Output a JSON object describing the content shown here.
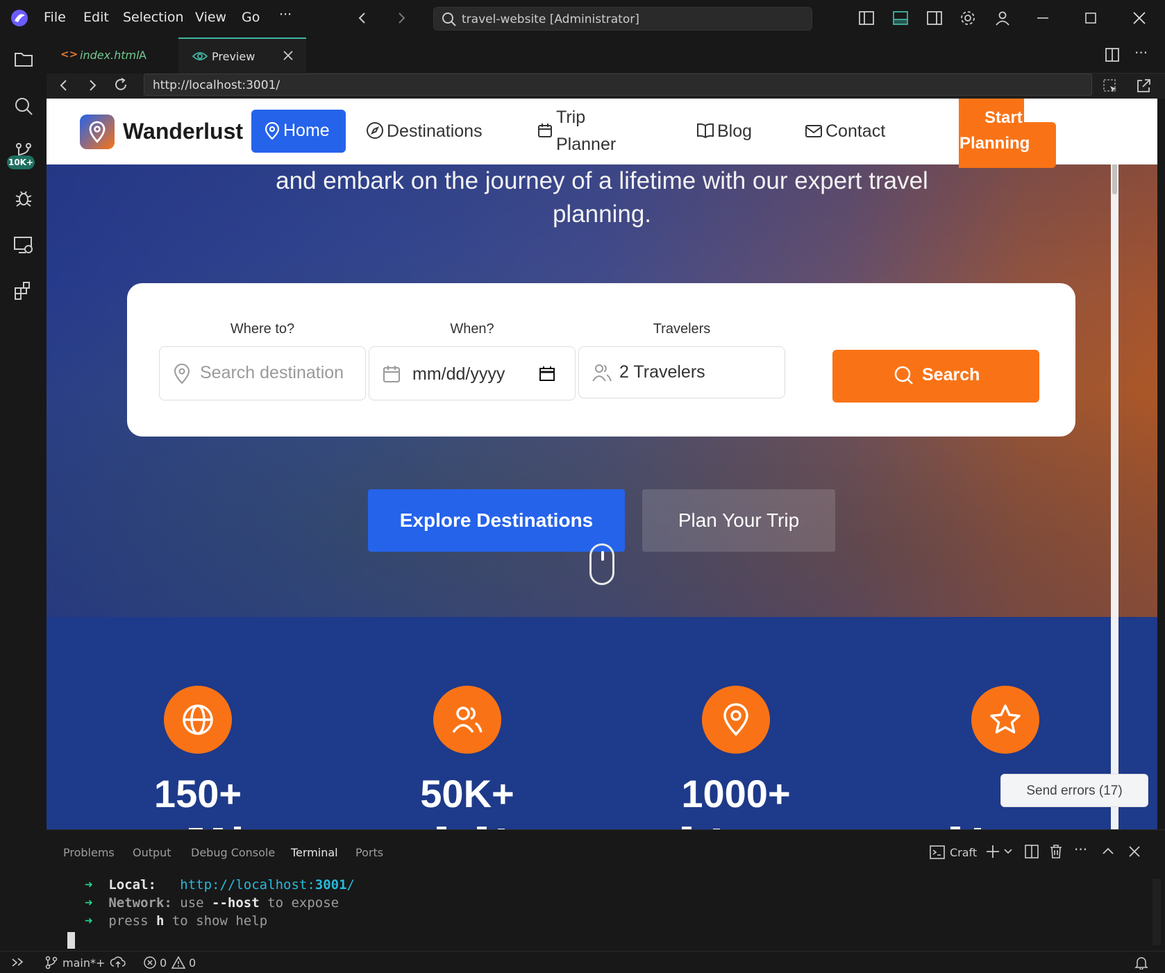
{
  "menu": [
    "File",
    "Edit",
    "Selection",
    "View",
    "Go",
    "···"
  ],
  "command_center": "travel-website [Administrator]",
  "tabs": {
    "index": {
      "name": "index.html",
      "badge": "A"
    },
    "preview": {
      "name": "Preview"
    }
  },
  "activity_badge": "10K+",
  "url": "http://localhost:3001/",
  "site": {
    "brand": "Wanderlust",
    "nav": {
      "home": "Home",
      "destinations": "Destinations",
      "trip_planner_1": "Trip",
      "trip_planner_2": "Planner",
      "blog": "Blog",
      "contact": "Contact",
      "cta_1": "Start",
      "cta_2": "Planning"
    },
    "hero": {
      "subtitle_1": "and embark on the journey of a lifetime with our expert travel",
      "subtitle_2": "planning.",
      "search": {
        "where_label": "Where to?",
        "where_placeholder": "Search destination",
        "when_label": "When?",
        "when_value": "mm/dd/yyyy",
        "travelers_label": "Travelers",
        "travelers_value": "2 Travelers",
        "button": "Search"
      },
      "explore_button": "Explore Destinations",
      "plan_button": "Plan Your Trip"
    },
    "stats": [
      {
        "value": "150+",
        "icon": "globe-icon"
      },
      {
        "value": "50K+",
        "icon": "users-icon"
      },
      {
        "value": "1000+",
        "icon": "map-pin-icon"
      },
      {
        "value": "4",
        "icon": "star-icon"
      }
    ],
    "send_errors": "Send errors (17)"
  },
  "panel": {
    "tabs": [
      "Problems",
      "Output",
      "Debug Console",
      "Terminal",
      "Ports"
    ],
    "active_tab": "Terminal",
    "terminal_name": "Craft",
    "lines": {
      "local_label": "Local:",
      "local_url_pre": "http://localhost:",
      "local_port": "3001",
      "local_slash": "/",
      "network_label": "Network:",
      "network_use": " use ",
      "network_flag": "--host",
      "network_rest": " to expose",
      "help_press": "press ",
      "help_key": "h",
      "help_rest": " to show help"
    }
  },
  "status": {
    "branch": "main*+",
    "errors": "0",
    "warnings": "0"
  },
  "colors": {
    "accent_teal": "#3fb5a3",
    "site_blue": "#2563eb",
    "site_orange": "#f97316",
    "stats_bg": "#1e3a8a"
  }
}
